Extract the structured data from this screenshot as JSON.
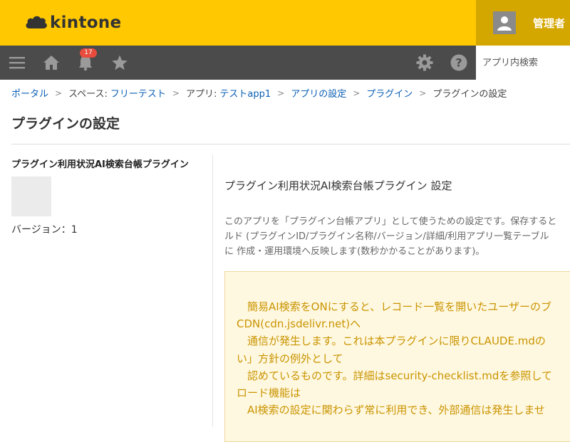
{
  "header": {
    "logo_text": "kintone",
    "user_name": "管理者"
  },
  "toolbar": {
    "notification_count": "17",
    "search_placeholder": "アプリ内検索"
  },
  "breadcrumb": {
    "portal": "ポータル",
    "space_prefix": "スペース: ",
    "space_name": "フリーテスト",
    "app_prefix": "アプリ: ",
    "app_name": "テストapp1",
    "app_settings": "アプリの設定",
    "plugins": "プラグイン",
    "current": "プラグインの設定",
    "separator": ">"
  },
  "page": {
    "title": "プラグインの設定"
  },
  "plugin": {
    "name": "プラグイン利用状況AI検索台帳プラグイン",
    "version": "バージョン：1"
  },
  "settings": {
    "title": "プラグイン利用状況AI検索台帳プラグイン 設定",
    "description": [
      "このアプリを「プラグイン台帳アプリ」として使うための設定です。保存すると",
      "ルド (プラグインID/プラグイン名称/バージョン/詳細/利用アプリ一覧テーブル",
      "に 作成・運用環境へ反映します(数秒かかることがあります)。"
    ],
    "notice": [
      "　簡易AI検索をONにすると、レコード一覧を開いたユーザーのブ",
      "CDN(cdn.jsdelivr.net)へ",
      "　通信が発生します。これは本プラグインに限りCLAUDE.mdの",
      "い」方針の例外として",
      "　認めているものです。詳細はsecurity-checklist.mdを参照して",
      "ロード機能は",
      "　AI検索の設定に関わらず常に利用でき、外部通信は発生しませ"
    ]
  },
  "colors": {
    "header_bg": "#ffc800",
    "toolbar_bg": "#4b4b4b",
    "link": "#0a5fb4",
    "notice_text": "#c99400",
    "badge": "#e74c3c"
  }
}
